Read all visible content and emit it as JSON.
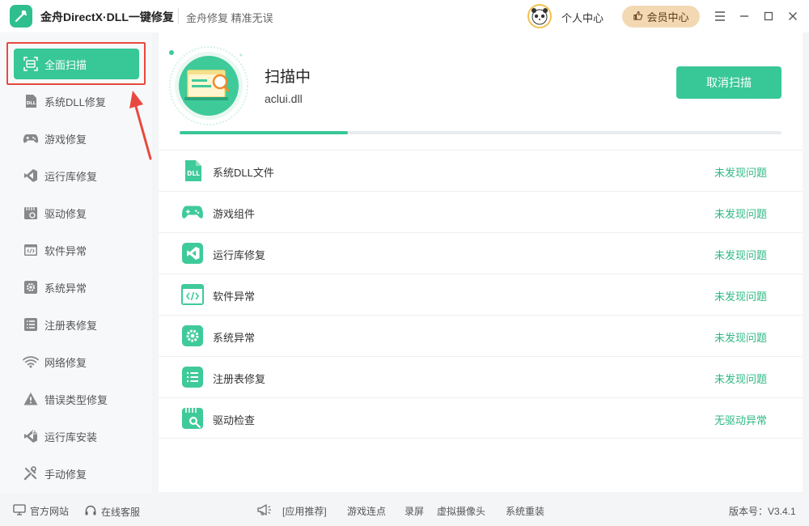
{
  "app": {
    "title": "金舟DirectX·DLL一键修复",
    "slogan": "金舟修复 精准无误"
  },
  "header": {
    "personal_center": "个人中心",
    "vip_center": "会员中心"
  },
  "sidebar": {
    "items": [
      {
        "label": "全面扫描",
        "icon": "scan-icon",
        "active": true
      },
      {
        "label": "系统DLL修复",
        "icon": "dll-icon",
        "active": false
      },
      {
        "label": "游戏修复",
        "icon": "gamepad-icon",
        "active": false
      },
      {
        "label": "运行库修复",
        "icon": "runtime-icon",
        "active": false
      },
      {
        "label": "驱动修复",
        "icon": "driver-icon",
        "active": false
      },
      {
        "label": "软件异常",
        "icon": "code-icon",
        "active": false
      },
      {
        "label": "系统异常",
        "icon": "gear-icon",
        "active": false
      },
      {
        "label": "注册表修复",
        "icon": "list-icon",
        "active": false
      },
      {
        "label": "网络修复",
        "icon": "wifi-icon",
        "active": false
      },
      {
        "label": "错误类型修复",
        "icon": "warning-icon",
        "active": false
      },
      {
        "label": "运行库安装",
        "icon": "install-icon",
        "active": false
      },
      {
        "label": "手动修复",
        "icon": "wrench-icon",
        "active": false
      }
    ]
  },
  "scan": {
    "title": "扫描中",
    "current_file": "aclui.dll",
    "cancel_label": "取消扫描",
    "progress": 0.28
  },
  "results": [
    {
      "name": "系统DLL文件",
      "status": "未发现问题",
      "icon": "dll-file-icon"
    },
    {
      "name": "游戏组件",
      "status": "未发现问题",
      "icon": "gamepad-icon"
    },
    {
      "name": "运行库修复",
      "status": "未发现问题",
      "icon": "runtime-icon"
    },
    {
      "name": "软件异常",
      "status": "未发现问题",
      "icon": "code-window-icon"
    },
    {
      "name": "系统异常",
      "status": "未发现问题",
      "icon": "gear-icon"
    },
    {
      "name": "注册表修复",
      "status": "未发现问题",
      "icon": "list-icon"
    },
    {
      "name": "驱动检查",
      "status": "无驱动异常",
      "icon": "driver-search-icon"
    }
  ],
  "footer": {
    "official_site": "官方网站",
    "online_service": "在线客服",
    "recommend": "[应用推荐]",
    "links": [
      "游戏连点",
      "录屏",
      "虚拟摄像头",
      "系统重装"
    ],
    "version": "版本号：V3.4.1"
  },
  "colors": {
    "accent": "#38c796",
    "status_ok": "#2fb884",
    "highlight_red": "#e8493f"
  }
}
